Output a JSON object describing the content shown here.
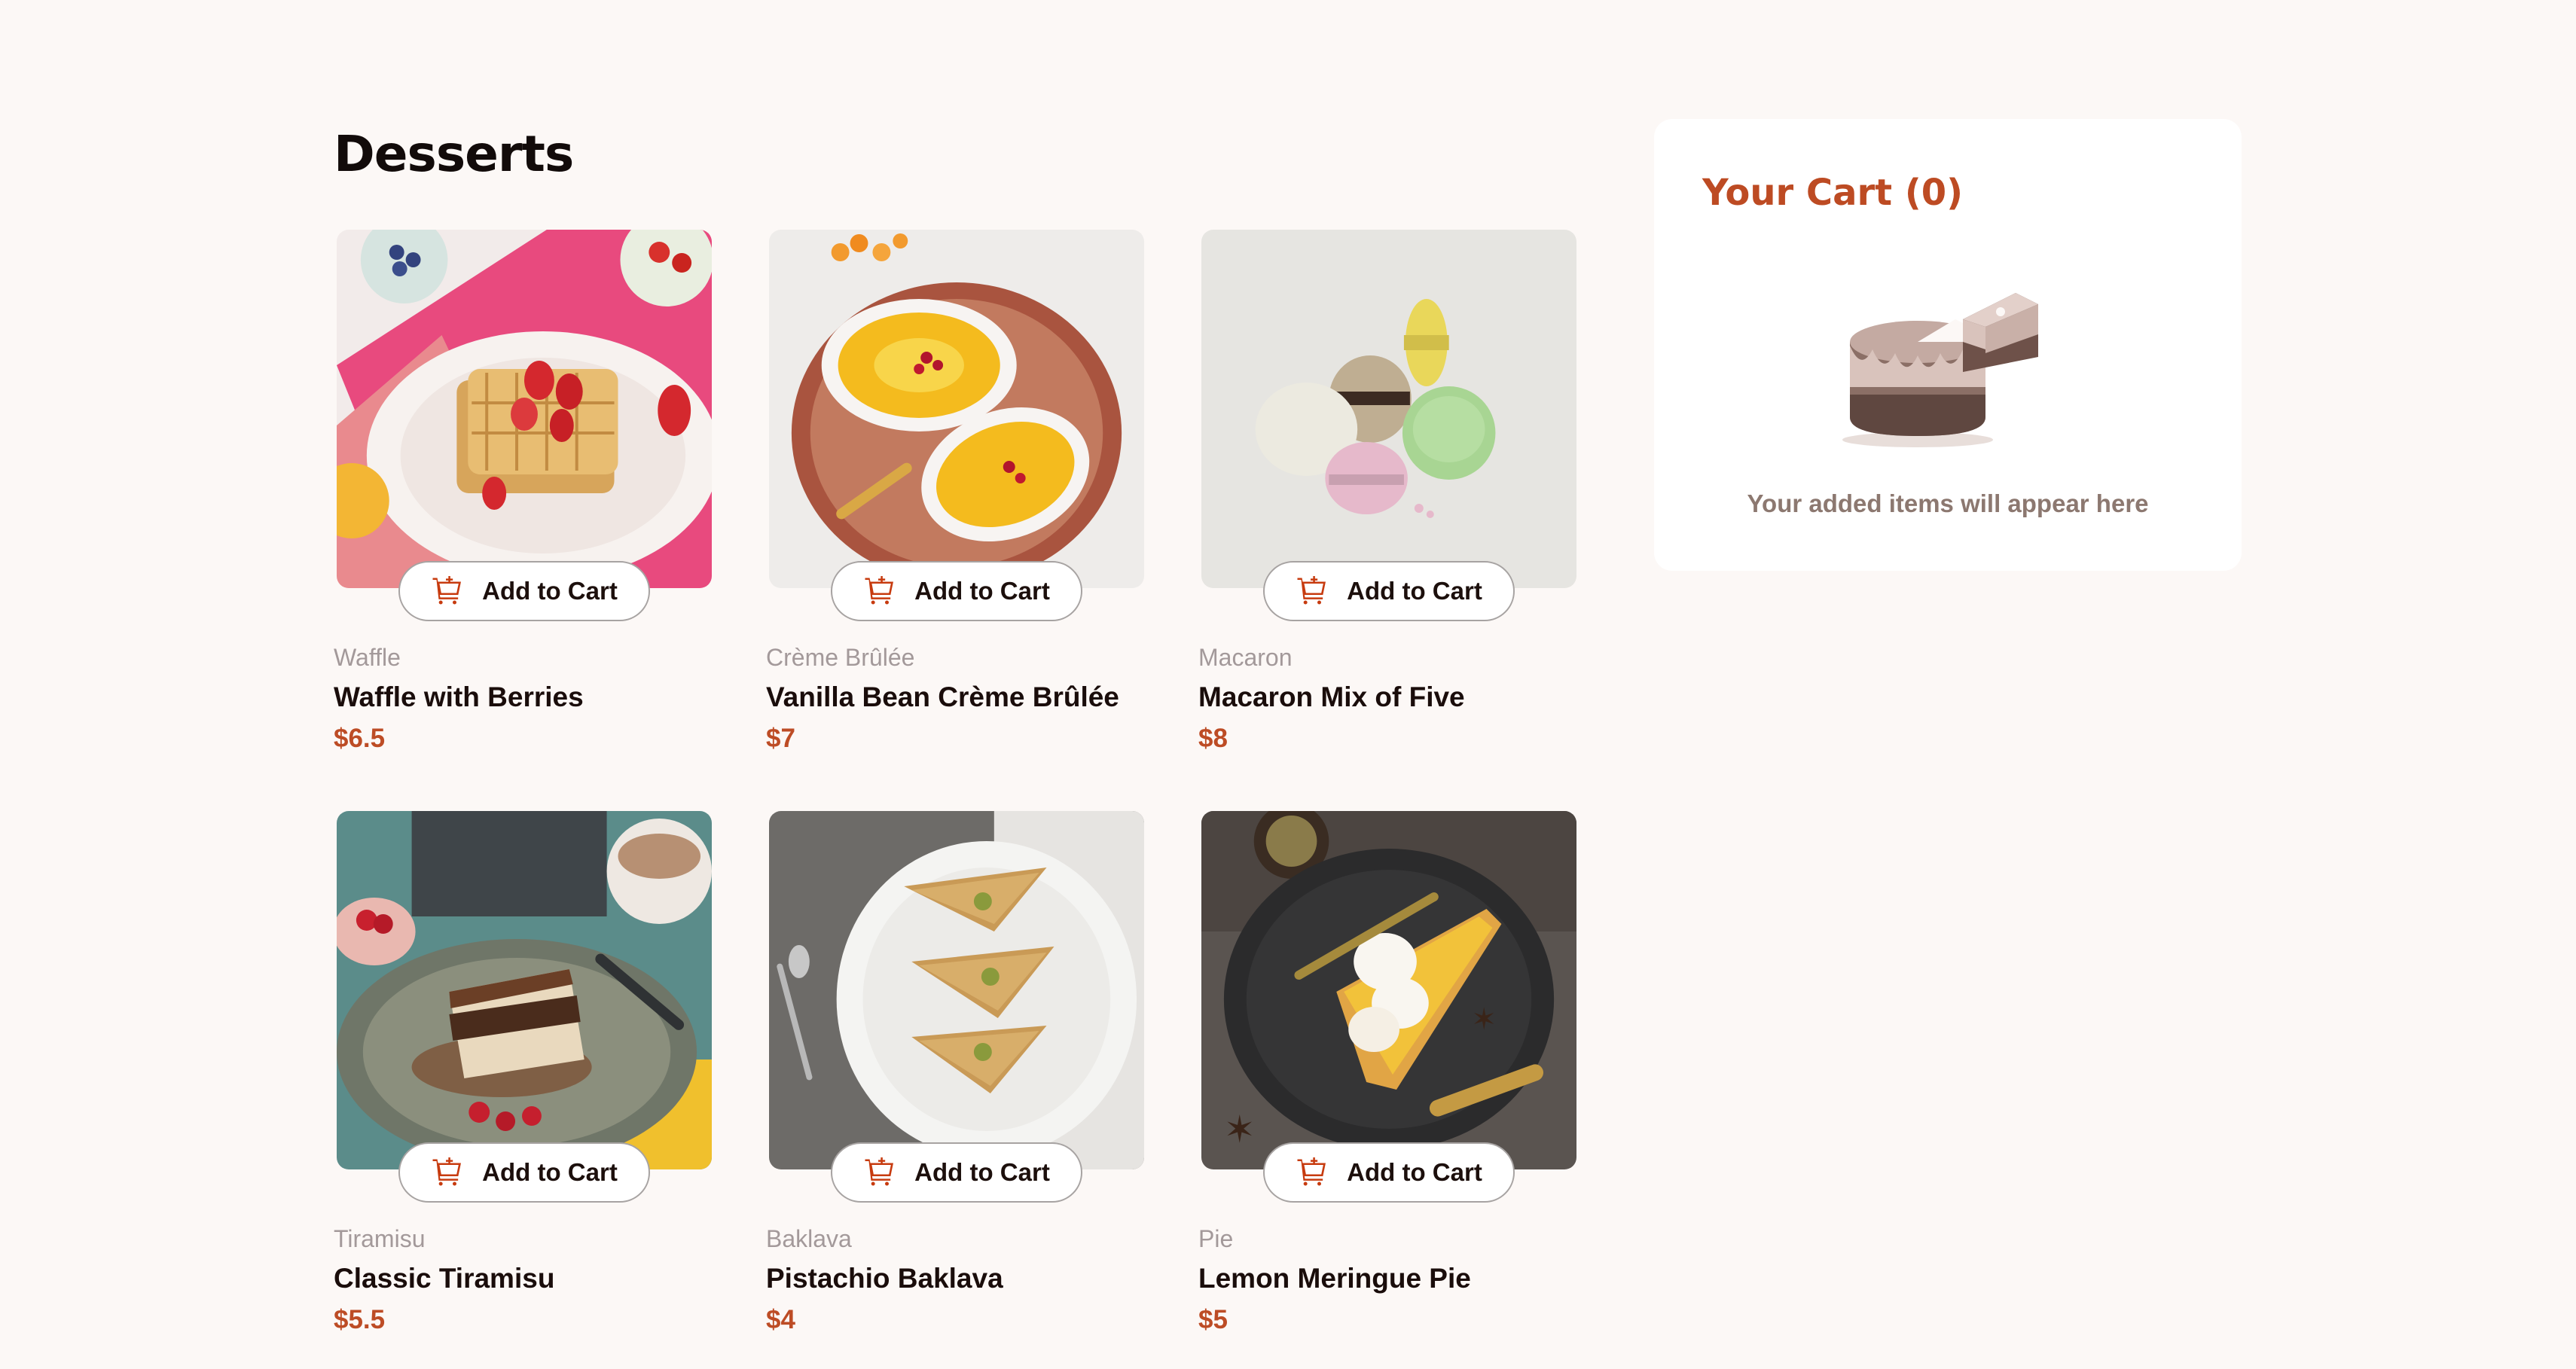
{
  "page": {
    "title": "Desserts"
  },
  "products": [
    {
      "category": "Waffle",
      "name": "Waffle with Berries",
      "price": "$6.5",
      "button_label": "Add to Cart"
    },
    {
      "category": "Crème Brûlée",
      "name": "Vanilla Bean Crème Brûlée",
      "price": "$7",
      "button_label": "Add to Cart"
    },
    {
      "category": "Macaron",
      "name": "Macaron Mix of Five",
      "price": "$8",
      "button_label": "Add to Cart"
    },
    {
      "category": "Tiramisu",
      "name": "Classic Tiramisu",
      "price": "$5.5",
      "button_label": "Add to Cart"
    },
    {
      "category": "Baklava",
      "name": "Pistachio Baklava",
      "price": "$4",
      "button_label": "Add to Cart"
    },
    {
      "category": "Pie",
      "name": "Lemon Meringue Pie",
      "price": "$5",
      "button_label": "Add to Cart"
    }
  ],
  "cart": {
    "title": "Your Cart (0)",
    "empty_message": "Your added items will appear here",
    "illustration_icon": "empty-cake-illustration"
  },
  "icons": {
    "add_to_cart": "add-to-cart-icon"
  },
  "colors": {
    "accent": "#C73B0F",
    "background": "#FCF8F6",
    "text": "#260F08",
    "muted": "#87635A"
  }
}
